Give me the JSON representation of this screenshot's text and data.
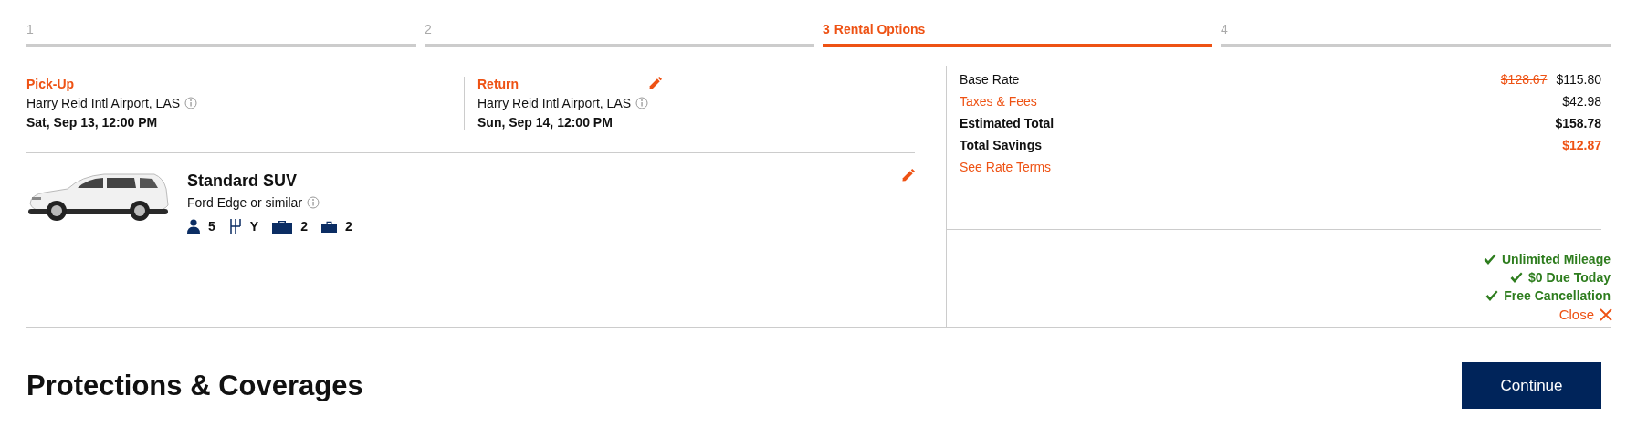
{
  "steps": [
    {
      "number": "1",
      "selected": false
    },
    {
      "number": "2",
      "selected": false
    },
    {
      "number": "3",
      "label": "Rental Options",
      "selected": true
    },
    {
      "number": "4",
      "selected": false
    }
  ],
  "pickup": {
    "label": "Pick-Up",
    "location": "Harry Reid Intl Airport, LAS",
    "datetime": "Sat, Sep 13, 12:00 PM"
  },
  "return": {
    "label": "Return",
    "location": "Harry Reid Intl Airport, LAS",
    "datetime": "Sun, Sep 14, 12:00 PM"
  },
  "vehicle": {
    "class": "Standard SUV",
    "model": "Ford Edge or similar",
    "features": [
      {
        "kind": "passengers",
        "value": "5"
      },
      {
        "kind": "transmission",
        "value": "Y"
      },
      {
        "kind": "large_bags",
        "value": "2"
      },
      {
        "kind": "small_bags",
        "value": "2"
      }
    ]
  },
  "summary": {
    "rows": [
      {
        "kind": "plain",
        "label": "Base Rate",
        "original_price": "$128.67",
        "value": "$115.80"
      },
      {
        "kind": "link",
        "label": "Taxes & Fees",
        "value": "$42.98"
      },
      {
        "kind": "total",
        "label": "Estimated Total",
        "value": "$158.78"
      },
      {
        "kind": "savings",
        "label": "Total Savings",
        "value": "$12.87"
      }
    ],
    "terms_link": "See Rate Terms",
    "benefits": [
      "Unlimited Mileage",
      "$0 Due Today",
      "Free Cancellation"
    ],
    "close": "Close"
  },
  "heading": "Protections & Coverages",
  "continue_button": "Continue"
}
